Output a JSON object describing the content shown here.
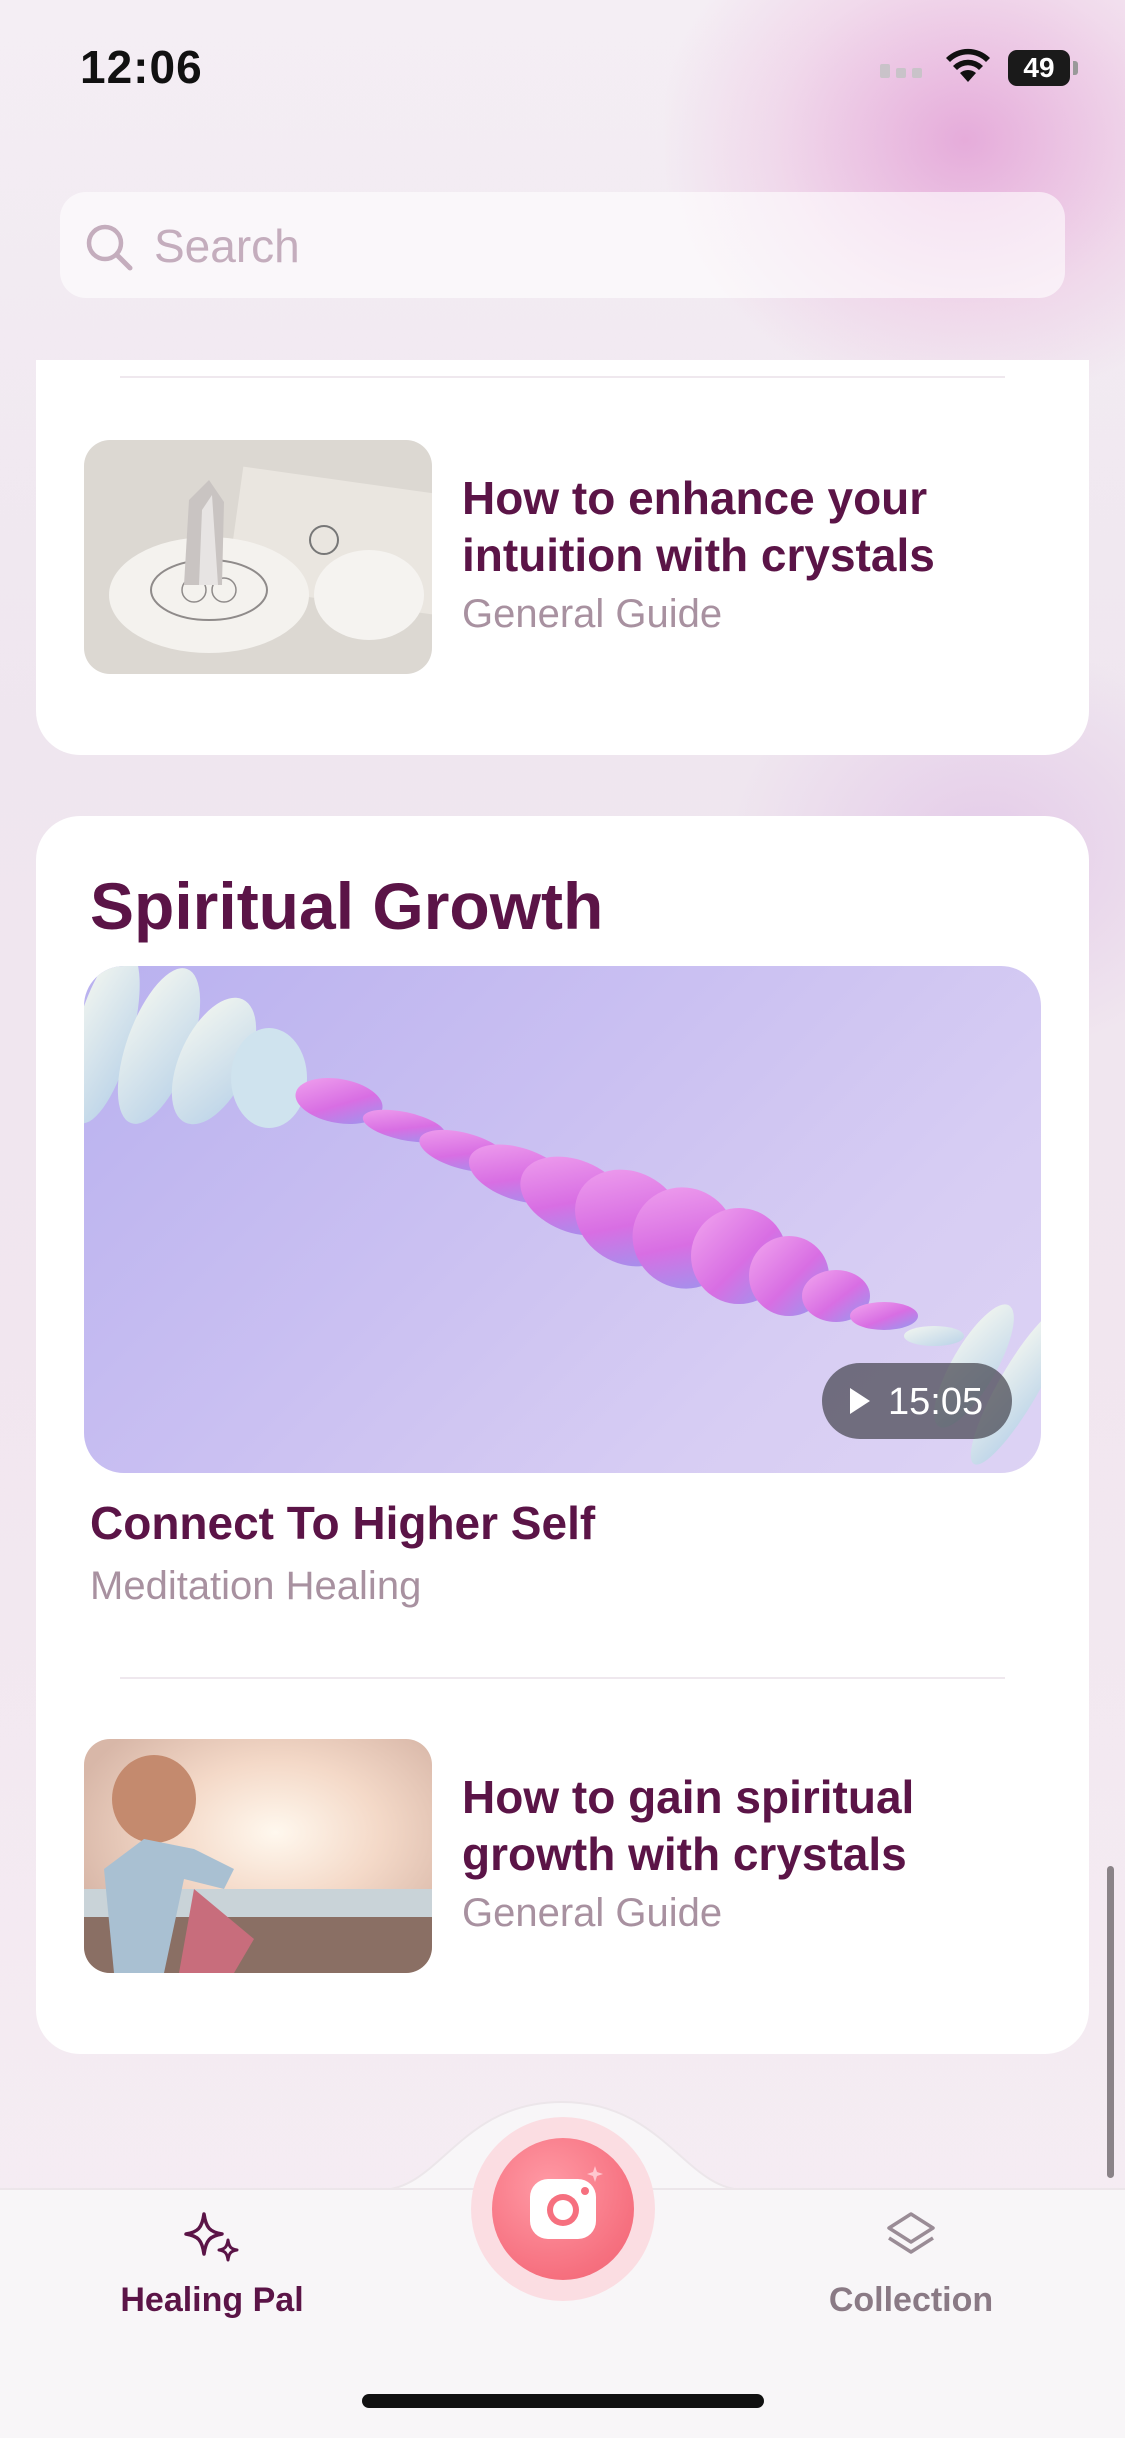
{
  "status_bar": {
    "time": "12:06",
    "battery": "49"
  },
  "search": {
    "placeholder": "Search",
    "value": ""
  },
  "top_card": {
    "item": {
      "title_line1": "How to enhance your",
      "title_line2": "intuition with crystals",
      "category": "General Guide",
      "thumbnail": "crystal-image"
    }
  },
  "section": {
    "title": "Spiritual Growth",
    "featured": {
      "title": "Connect To Higher Self",
      "category": "Meditation Healing",
      "duration": "15:05",
      "thumbnail": "abstract-ripple-video"
    },
    "item": {
      "title_line1": "How to gain spiritual",
      "title_line2": "growth with crystals",
      "category": "General Guide",
      "thumbnail": "child-beach-image"
    }
  },
  "tab_bar": {
    "left": {
      "label": "Healing Pal",
      "icon": "sparkles-icon"
    },
    "center": {
      "icon": "camera-icon"
    },
    "right": {
      "label": "Collection",
      "icon": "layers-icon"
    }
  },
  "colors": {
    "primary_text": "#5b1447",
    "secondary_text": "#a891a0",
    "accent": "#f6707f"
  }
}
